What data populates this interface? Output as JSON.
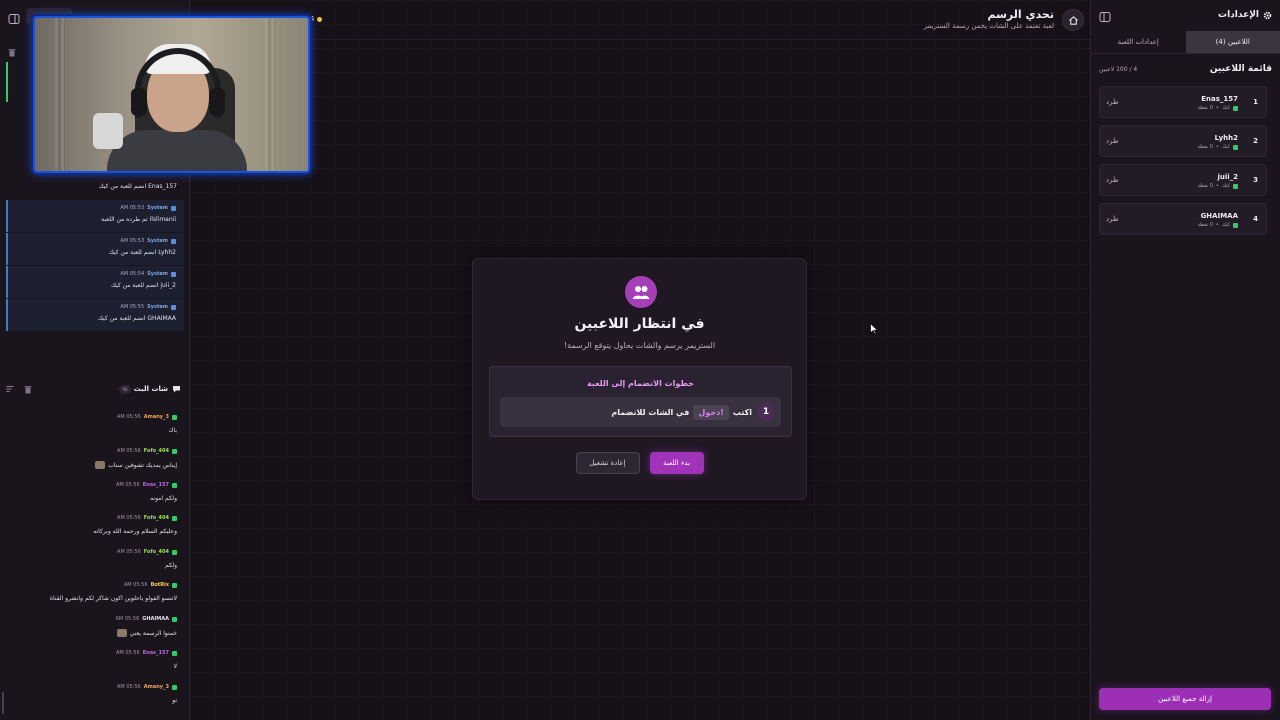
{
  "header": {
    "title": "تحدي الرسم",
    "subtitle": "لعبة تعتمد على الشات يخمن رسمة الستريمر",
    "player_count": "4"
  },
  "waiting": {
    "title": "في انتظار اللاعبين",
    "subtitle": "الستريمر يرسم والشات يحاول يتوقع الرسمة!",
    "steps_title": "خطوات الانضمام إلى اللعبة",
    "step_number": "1",
    "step_prefix": "اكتب",
    "step_keyword": "!دخول",
    "step_suffix": "في الشات للانضمام",
    "start_button": "بدء اللعبة",
    "reset_button": "إعادة تشغيل"
  },
  "settings": {
    "title": "الإعدادات",
    "tabs": [
      "اللاعبين (4)",
      "إعدادات اللعبة"
    ],
    "players_title": "قائمة اللاعبين",
    "players_count": "4 / 100 لاعبين",
    "players": [
      {
        "rank": "1",
        "name": "Enas_157",
        "platform": "كيك",
        "points": "0 نقطة",
        "kick": "طرد"
      },
      {
        "rank": "2",
        "name": "Lyhh2",
        "platform": "كيك",
        "points": "0 نقطة",
        "kick": "طرد"
      },
      {
        "rank": "3",
        "name": "juii_2",
        "platform": "كيك",
        "points": "0 نقطة",
        "kick": "طرد"
      },
      {
        "rank": "4",
        "name": "GHAIMAA",
        "platform": "كيك",
        "points": "0 نقطة",
        "kick": "طرد"
      }
    ],
    "remove_all": "إزالة جميع اللاعبين"
  },
  "system_feed": {
    "first_text": "Enas_157 انضم للعبة من كيك",
    "messages": [
      {
        "who": "System",
        "time": "05:53 AM",
        "text": "ilslimanii تم طرده من اللعبة"
      },
      {
        "who": "System",
        "time": "05:53 AM",
        "text": "Lyhh2 انضم للعبة من كيك"
      },
      {
        "who": "System",
        "time": "05:54 AM",
        "text": "juii_2 انضم للعبة من كيك"
      },
      {
        "who": "System",
        "time": "05:55 AM",
        "text": "GHAIMAA انضم للعبة من كيك"
      }
    ]
  },
  "chat": {
    "title": "شات البث",
    "count": "96",
    "messages": [
      {
        "user": "Amany_3",
        "color": "#f2a65a",
        "time": "05:56 AM",
        "text": "باك",
        "emote": false
      },
      {
        "user": "Fofo_404",
        "color": "#9be15d",
        "time": "05:56 AM",
        "text": "إيناس يمديك تشوفين سناب",
        "emote": true
      },
      {
        "user": "Enas_157",
        "color": "#b86bdc",
        "time": "05:56 AM",
        "text": "ولكم امونه",
        "emote": false
      },
      {
        "user": "Fofo_404",
        "color": "#9be15d",
        "time": "05:56 AM",
        "text": "وعليكم السلام ورحمة الله وبركاته",
        "emote": false
      },
      {
        "user": "Fofo_404",
        "color": "#9be15d",
        "time": "05:56 AM",
        "text": "ولكم",
        "emote": false
      },
      {
        "user": "BotRix",
        "color": "#f5d547",
        "time": "05:56 AM",
        "text": "لاتنسو الفولو ياحلوين اكون شاكر لكم وانشرو القناة",
        "emote": false
      },
      {
        "user": "GHAIMAA",
        "color": "#e7e1ea",
        "time": "05:56 AM",
        "text": "خمنوا الرسمة يعني",
        "emote": true
      },
      {
        "user": "Enas_157",
        "color": "#b86bdc",
        "time": "05:56 AM",
        "text": "لا",
        "emote": false
      },
      {
        "user": "Amany_3",
        "color": "#f2a65a",
        "time": "05:56 AM",
        "text": "تو",
        "emote": false
      }
    ]
  },
  "colors": {
    "accent": "#a133b8",
    "kick_green": "#35c96b",
    "webcam_border": "#1b54d8",
    "system_blue": "#3c7cc9"
  },
  "icons": [
    "home-icon",
    "users-icon",
    "gear-icon",
    "sidebar-collapse-icon",
    "trash-icon",
    "chat-bubble-icon",
    "list-filter-icon",
    "cursor-icon"
  ]
}
